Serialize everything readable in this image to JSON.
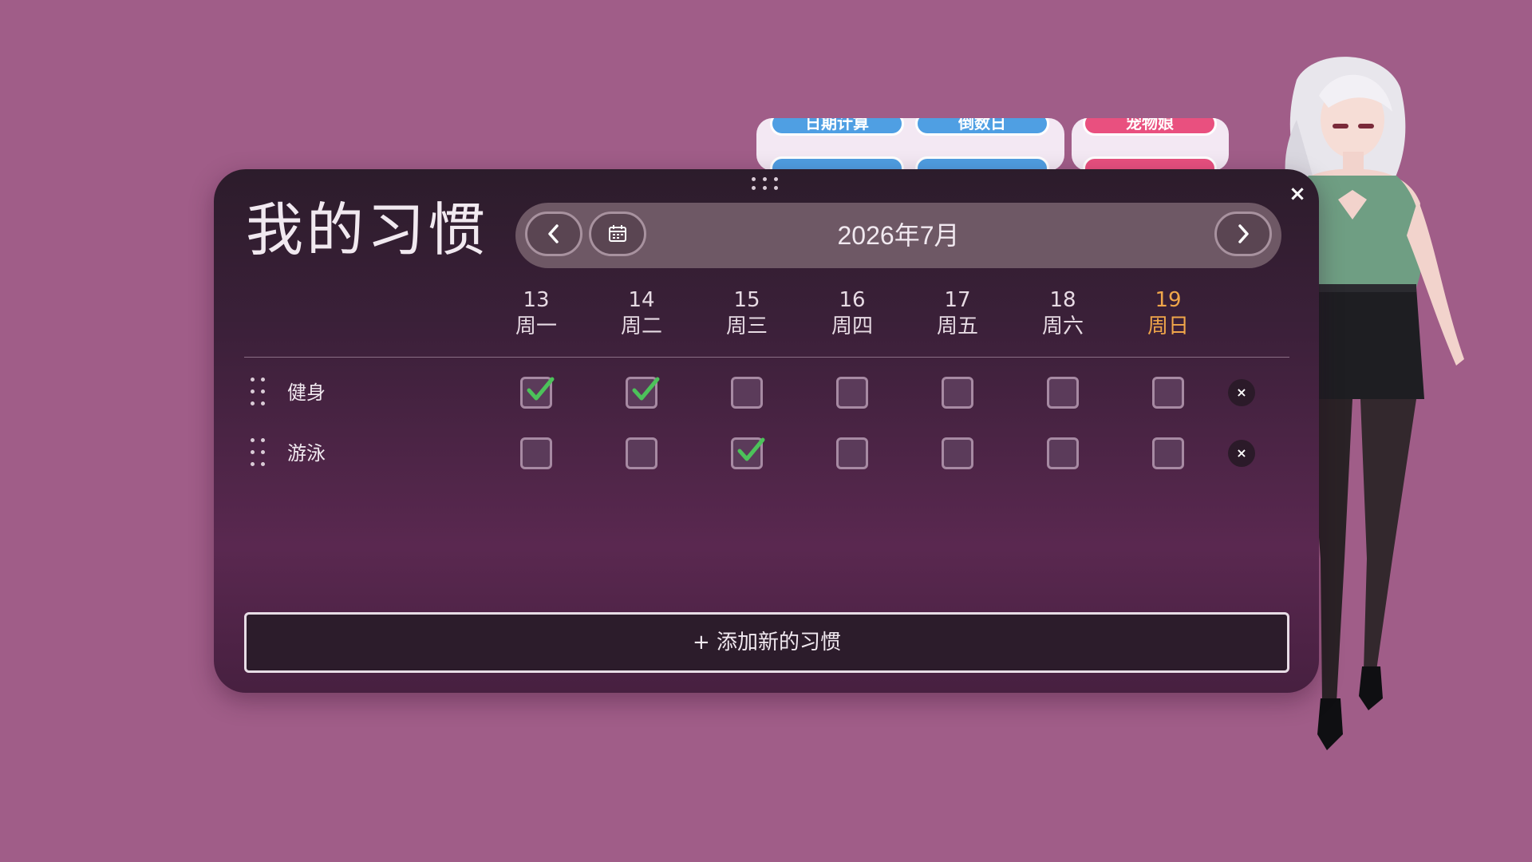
{
  "background_widgets": [
    {
      "label": "日期计算",
      "color": "#4f9fe3"
    },
    {
      "label": "倒数日",
      "color": "#4f9fe3"
    },
    {
      "label": "宠物娘",
      "color": "#e9507f"
    }
  ],
  "panel": {
    "title": "我的习惯",
    "close_icon": "×",
    "nav": {
      "month_label": "2026年7月",
      "prev_icon": "chevron-left",
      "calendar_icon": "calendar",
      "next_icon": "chevron-right"
    },
    "days": [
      {
        "date": "13",
        "weekday": "周一",
        "today": false
      },
      {
        "date": "14",
        "weekday": "周二",
        "today": false
      },
      {
        "date": "15",
        "weekday": "周三",
        "today": false
      },
      {
        "date": "16",
        "weekday": "周四",
        "today": false
      },
      {
        "date": "17",
        "weekday": "周五",
        "today": false
      },
      {
        "date": "18",
        "weekday": "周六",
        "today": false
      },
      {
        "date": "19",
        "weekday": "周日",
        "today": true
      }
    ],
    "habits": [
      {
        "name": "健身",
        "checks": [
          true,
          true,
          false,
          false,
          false,
          false,
          false
        ]
      },
      {
        "name": "游泳",
        "checks": [
          false,
          false,
          true,
          false,
          false,
          false,
          false
        ]
      }
    ],
    "delete_icon": "×",
    "add_label": "+  添加新的习惯"
  },
  "colors": {
    "today": "#f0a64a",
    "check": "#4cc25a",
    "background": "#a05d88"
  }
}
